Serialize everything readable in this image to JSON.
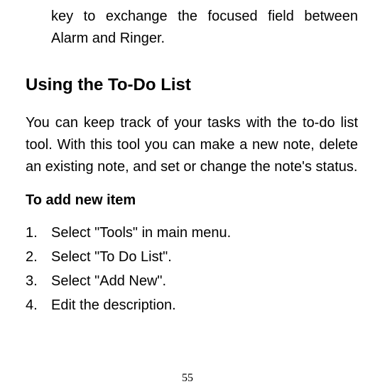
{
  "fragment": "key to exchange the focused field between Alarm and Ringer.",
  "heading": "Using the To-Do List",
  "intro": "You can keep track of your tasks with the to-do list tool. With this tool you can make a new note, delete an existing note, and set or change the note's status.",
  "subheading": "To add new item",
  "steps": [
    {
      "n": "1.",
      "text": "Select \"Tools\" in main menu."
    },
    {
      "n": "2.",
      "text": "Select \"To Do List\"."
    },
    {
      "n": "3.",
      "text": "Select \"Add New\"."
    },
    {
      "n": "4.",
      "text": "Edit the description."
    }
  ],
  "page_number": "55"
}
